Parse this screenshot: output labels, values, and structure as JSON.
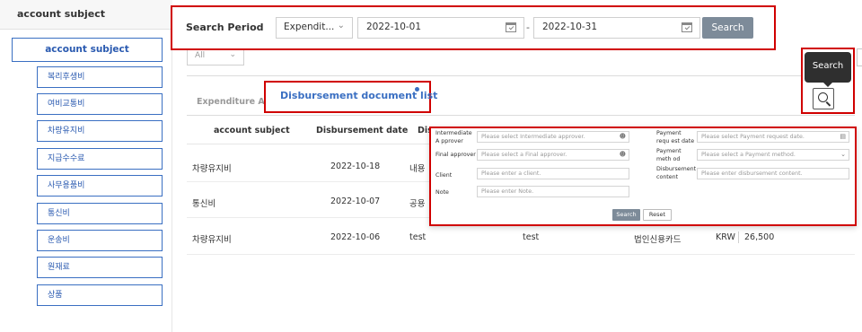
{
  "sidebar": {
    "header": "account subject",
    "root_label": "account subject",
    "items": [
      {
        "label": "복리후생비"
      },
      {
        "label": "여비교통비"
      },
      {
        "label": "차량유지비"
      },
      {
        "label": "지급수수료"
      },
      {
        "label": "사무용품비"
      },
      {
        "label": "통신비"
      },
      {
        "label": "운송비"
      },
      {
        "label": "원재료"
      },
      {
        "label": "상품"
      }
    ]
  },
  "search_period": {
    "label": "Search Period",
    "type_selected": "Expendit...",
    "start_date": "2022-10-01",
    "end_date": "2022-10-31",
    "separator": "-",
    "button_label": "Search"
  },
  "filter": {
    "selected": "All"
  },
  "icons": {
    "chevron": "chevron-down-icon",
    "calendar": "calendar-icon",
    "search": "search-icon",
    "person": "person-icon"
  },
  "tooltip": {
    "text": "Search"
  },
  "tabs": [
    {
      "label": "Expenditure Amou"
    },
    {
      "label": "Disbursement document list",
      "active": true
    }
  ],
  "table": {
    "columns": [
      "account subject",
      "Disbursement date",
      "Dis"
    ],
    "rows": [
      {
        "subject": "차량유지비",
        "date": "2022-10-18",
        "content": "내용"
      },
      {
        "subject": "통신비",
        "date": "2022-10-07",
        "content": "공용"
      },
      {
        "subject": "차량유지비",
        "date": "2022-10-06",
        "content": "test",
        "client": "test",
        "method": "법인신용카드",
        "currency": "KRW",
        "amount": "26,500"
      }
    ]
  },
  "search_form": {
    "intermediate_label": "Intermediate A pprover",
    "intermediate_placeholder": "Please select Intermediate approver.",
    "final_label": "Final approver",
    "final_placeholder": "Please select a Final approver.",
    "client_label": "Client",
    "client_placeholder": "Please enter a client.",
    "note_label": "Note",
    "note_placeholder": "Please enter Note.",
    "payment_date_label": "Payment requ est date",
    "payment_date_placeholder": "Please select Payment request date.",
    "payment_method_label": "Payment meth od",
    "payment_method_placeholder": "Please select a Payment method.",
    "content_label": "Disbursement content",
    "content_placeholder": "Please enter disbursement content.",
    "search_button": "Search",
    "reset_button": "Reset"
  },
  "colors": {
    "accent": "#3a6fc2",
    "highlight": "#d00000",
    "button": "#7d8b99"
  }
}
